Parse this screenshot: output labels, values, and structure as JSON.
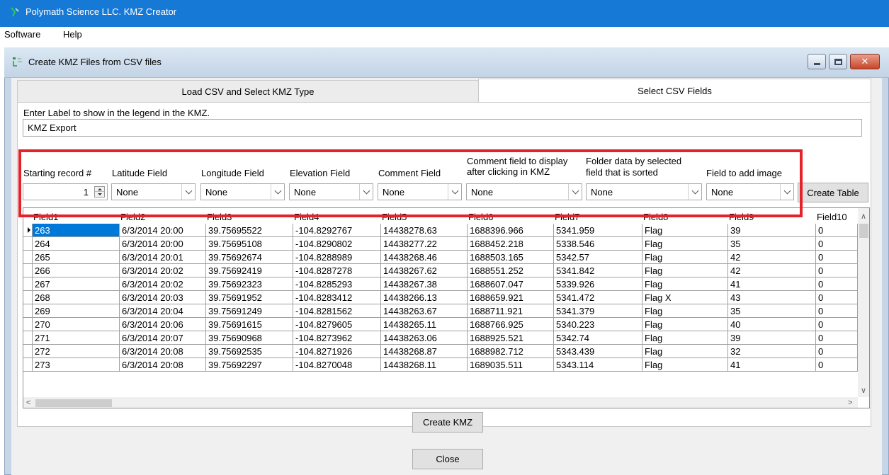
{
  "app": {
    "title": "Polymath Science LLC. KMZ Creator"
  },
  "menu": {
    "items": [
      "Software",
      "Help"
    ]
  },
  "child_window": {
    "title": "Create KMZ Files from CSV files",
    "close_glyph": "✕"
  },
  "tabs": [
    {
      "label": "Load CSV and Select KMZ Type"
    },
    {
      "label": "Select CSV Fields"
    }
  ],
  "legend": {
    "label": "Enter Label to show in the legend in the KMZ.",
    "value": "KMZ Export"
  },
  "fields": {
    "starting_record": {
      "label": "Starting record #",
      "value": "1"
    },
    "latitude": {
      "label": "Latitude Field",
      "value": "None"
    },
    "longitude": {
      "label": "Longitude Field",
      "value": "None"
    },
    "elevation": {
      "label": "Elevation Field",
      "value": "None"
    },
    "comment": {
      "label": "Comment Field",
      "value": "None"
    },
    "comment_display": {
      "label_line1": "Comment field to display",
      "label_line2": "after clicking in KMZ",
      "value": "None"
    },
    "folder": {
      "label_line1": "Folder data by selected",
      "label_line2": "field that is sorted",
      "value": "None"
    },
    "image": {
      "label": "Field to add image",
      "value": "None"
    },
    "create_table_label": "Create Table"
  },
  "table": {
    "columns": [
      "Field1",
      "Field2",
      "Field3",
      "Field4",
      "Field5",
      "Field6",
      "Field7",
      "Field8",
      "Field9",
      "Field10"
    ],
    "rows": [
      [
        "263",
        "6/3/2014 20:00",
        "39.75695522",
        "-104.8292767",
        "14438278.63",
        "1688396.966",
        "5341.959",
        "Flag",
        "39",
        "0"
      ],
      [
        "264",
        "6/3/2014 20:00",
        "39.75695108",
        "-104.8290802",
        "14438277.22",
        "1688452.218",
        "5338.546",
        "Flag",
        "35",
        "0"
      ],
      [
        "265",
        "6/3/2014 20:01",
        "39.75692674",
        "-104.8288989",
        "14438268.46",
        "1688503.165",
        "5342.57",
        "Flag",
        "42",
        "0"
      ],
      [
        "266",
        "6/3/2014 20:02",
        "39.75692419",
        "-104.8287278",
        "14438267.62",
        "1688551.252",
        "5341.842",
        "Flag",
        "42",
        "0"
      ],
      [
        "267",
        "6/3/2014 20:02",
        "39.75692323",
        "-104.8285293",
        "14438267.38",
        "1688607.047",
        "5339.926",
        "Flag",
        "41",
        "0"
      ],
      [
        "268",
        "6/3/2014 20:03",
        "39.75691952",
        "-104.8283412",
        "14438266.13",
        "1688659.921",
        "5341.472",
        "Flag X",
        "43",
        "0"
      ],
      [
        "269",
        "6/3/2014 20:04",
        "39.75691249",
        "-104.8281562",
        "14438263.67",
        "1688711.921",
        "5341.379",
        "Flag",
        "35",
        "0"
      ],
      [
        "270",
        "6/3/2014 20:06",
        "39.75691615",
        "-104.8279605",
        "14438265.11",
        "1688766.925",
        "5340.223",
        "Flag",
        "40",
        "0"
      ],
      [
        "271",
        "6/3/2014 20:07",
        "39.75690968",
        "-104.8273962",
        "14438263.06",
        "1688925.521",
        "5342.74",
        "Flag",
        "39",
        "0"
      ],
      [
        "272",
        "6/3/2014 20:08",
        "39.75692535",
        "-104.8271926",
        "14438268.87",
        "1688982.712",
        "5343.439",
        "Flag",
        "32",
        "0"
      ],
      [
        "273",
        "6/3/2014 20:08",
        "39.75692297",
        "-104.8270048",
        "14438268.11",
        "1689035.511",
        "5343.114",
        "Flag",
        "41",
        "0"
      ]
    ]
  },
  "buttons": {
    "create_kmz": "Create KMZ",
    "close": "Close"
  },
  "colors": {
    "titlebar": "#1679d6",
    "highlight": "#e4222a",
    "selection": "#0078d7"
  }
}
